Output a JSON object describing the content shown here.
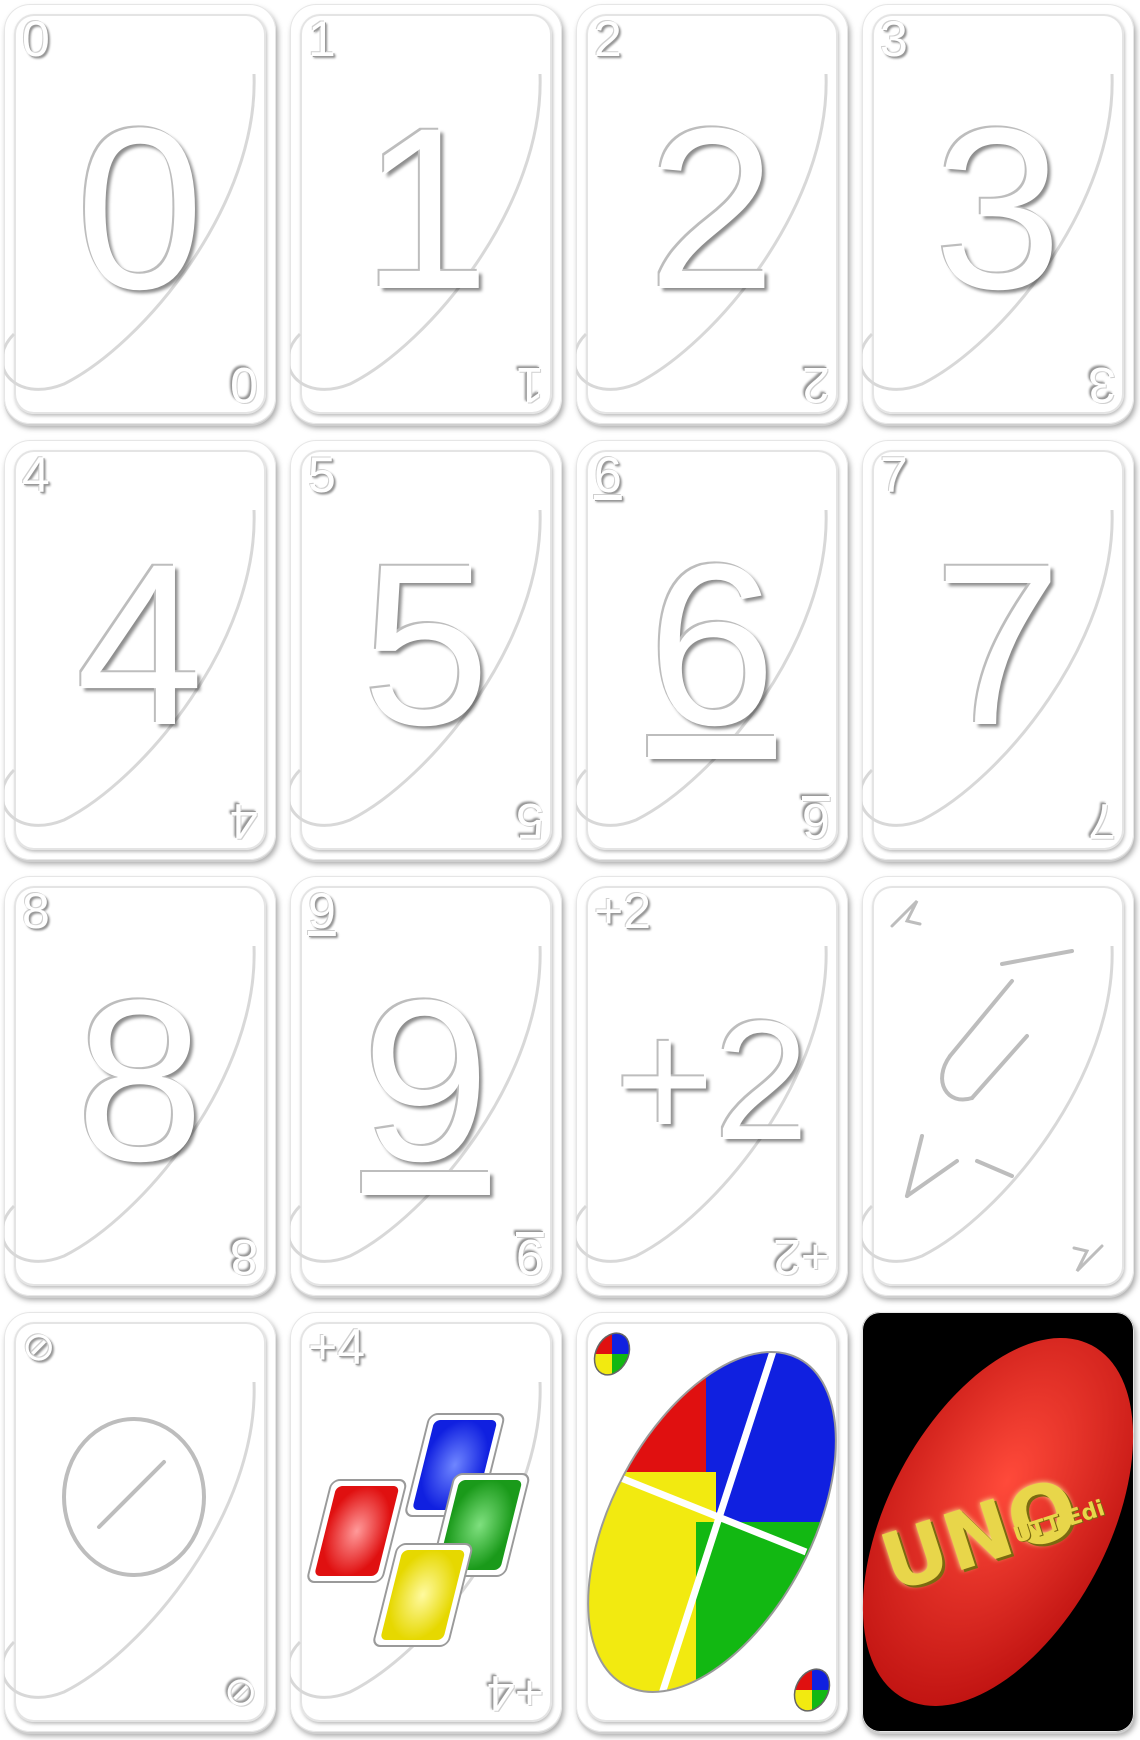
{
  "sheet_title": "",
  "cards": [
    {
      "id": "card-0",
      "corner": "0",
      "center": "0",
      "kind": "number"
    },
    {
      "id": "card-1",
      "corner": "1",
      "center": "1",
      "kind": "number"
    },
    {
      "id": "card-2",
      "corner": "2",
      "center": "2",
      "kind": "number"
    },
    {
      "id": "card-3",
      "corner": "3",
      "center": "3",
      "kind": "number"
    },
    {
      "id": "card-4",
      "corner": "4",
      "center": "4",
      "kind": "number"
    },
    {
      "id": "card-5",
      "corner": "5",
      "center": "5",
      "kind": "number"
    },
    {
      "id": "card-6",
      "corner": "6",
      "center": "6",
      "kind": "number"
    },
    {
      "id": "card-7",
      "corner": "7",
      "center": "7",
      "kind": "number"
    },
    {
      "id": "card-8",
      "corner": "8",
      "center": "8",
      "kind": "number"
    },
    {
      "id": "card-9",
      "corner": "9",
      "center": "9",
      "kind": "number"
    },
    {
      "id": "card-draw-two",
      "corner": "+2",
      "center": "+2",
      "kind": "draw-two"
    },
    {
      "id": "card-reverse",
      "corner": "",
      "center": "",
      "kind": "reverse",
      "icon": "reverse-arrows-icon"
    },
    {
      "id": "card-skip",
      "corner": "⊘",
      "center": "⊘",
      "kind": "skip",
      "icon": "skip-icon"
    },
    {
      "id": "card-wild-draw-four",
      "corner": "+4",
      "center": "",
      "kind": "wild-draw-four",
      "icon": "four-color-cards-icon"
    },
    {
      "id": "card-wild",
      "corner": "",
      "center": "",
      "kind": "wild",
      "icon": "four-color-oval-icon"
    },
    {
      "id": "card-back",
      "corner": "",
      "center": "",
      "kind": "back",
      "logo": "UNO",
      "edition": "UTT Edi"
    }
  ],
  "colors": {
    "red": "#e01010",
    "blue": "#1020e0",
    "green": "#12b812",
    "yellow": "#f2ea10",
    "back_oval": "#d81818",
    "logo_gold": "#e8d64a"
  }
}
